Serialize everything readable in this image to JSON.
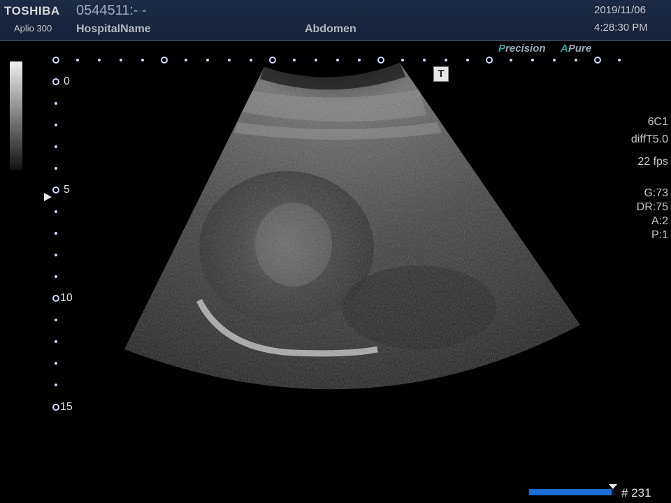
{
  "header": {
    "brand": "TOSHIBA",
    "model": "Aplio 300",
    "patient_id": "0544511:- -",
    "hospital": "HospitalName",
    "preset": "Abdomen",
    "date": "2019/11/06",
    "time": "4:28:30 PM"
  },
  "image_modes": {
    "precision_first": "P",
    "precision_rest": "recision",
    "apure_first": "A",
    "apure_rest": "Pure"
  },
  "scan_params": {
    "probe": "6C1",
    "frequency": "diffT5.0",
    "frame_rate": "22 fps",
    "gain": "G:73",
    "dynamic_range": "DR:75",
    "a": "A:2",
    "p": "P:1"
  },
  "depth_scale": {
    "labels": [
      "0",
      "5",
      "10",
      "15"
    ],
    "units": "cm"
  },
  "body_marker": "T",
  "cine": {
    "frame_label": "# 231",
    "progress": 0.97
  },
  "colors": {
    "header_bg": "#1c2a44",
    "accent_teal": "#2fa7a0",
    "cine_blue": "#1b6cd6"
  }
}
